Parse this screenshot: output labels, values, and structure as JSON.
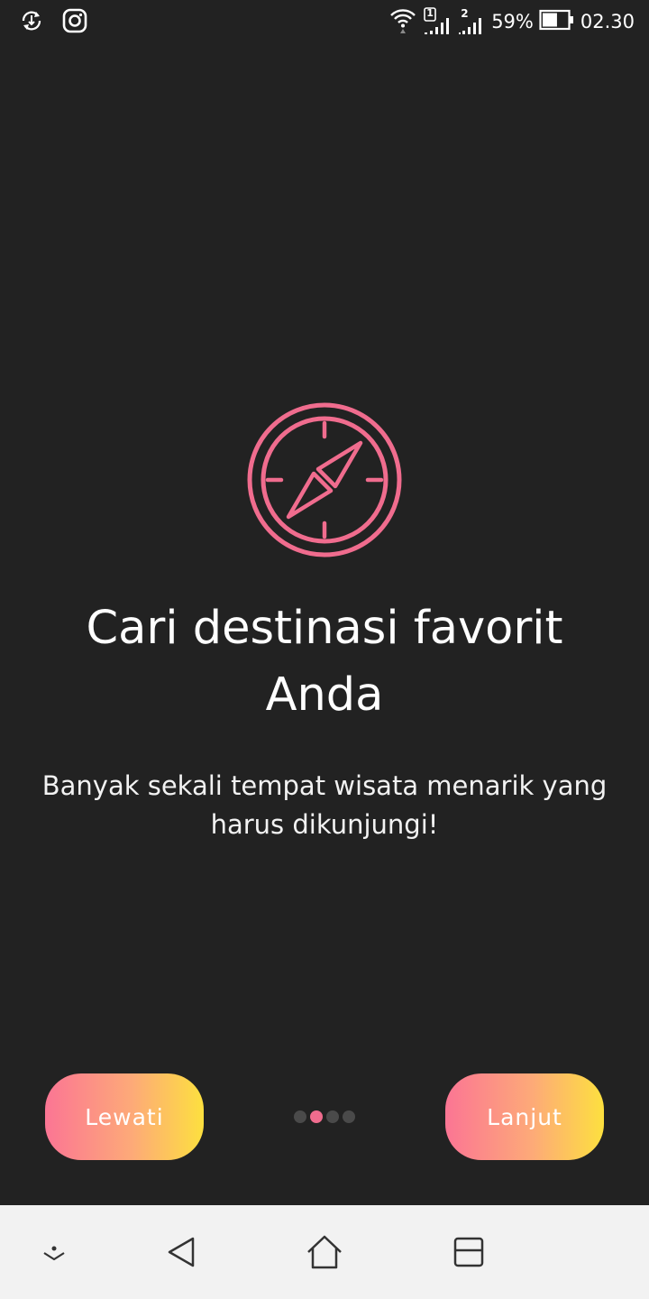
{
  "status_bar": {
    "battery_percent": "59%",
    "battery_level": 0.59,
    "time": "02.30",
    "sim1_label": "1",
    "sim2_label": "2",
    "icons": [
      "download-sync-icon",
      "instagram-icon",
      "wifi-icon",
      "signal-sim1-icon",
      "signal-sim2-icon",
      "battery-icon"
    ]
  },
  "onboarding": {
    "icon": "compass-icon",
    "title": "Cari destinasi favorit Anda",
    "subtitle": "Banyak sekali tempat wisata menarik yang harus dikunjungi!",
    "skip_label": "Lewati",
    "next_label": "Lanjut",
    "page_count": 4,
    "active_page": 2
  },
  "nav_bar": {
    "icons": [
      "hide-nav-icon",
      "back-icon",
      "home-icon",
      "recent-apps-icon"
    ]
  },
  "colors": {
    "background": "#222222",
    "accent": "#f06c8e",
    "gradient_start": "#fb7594",
    "gradient_end": "#fde03f",
    "nav_background": "#f2f2f2"
  }
}
